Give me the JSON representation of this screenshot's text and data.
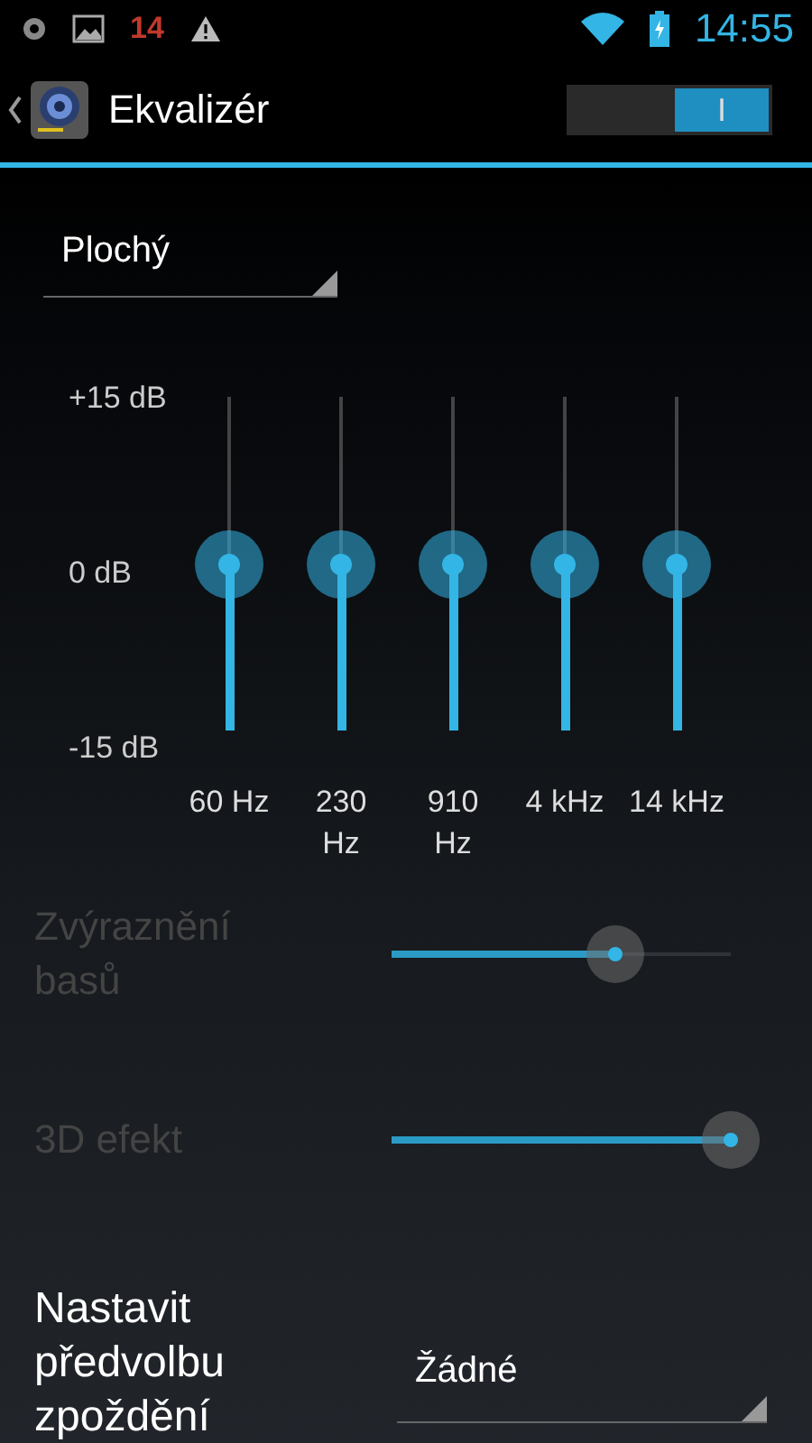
{
  "status_bar": {
    "notification_count": "14",
    "time": "14:55"
  },
  "action_bar": {
    "title": "Ekvalizér",
    "switch": {
      "on": true,
      "label": "I"
    }
  },
  "preset": {
    "value": "Plochý"
  },
  "equalizer": {
    "scale": [
      "+15 dB",
      "0 dB",
      "-15 dB"
    ],
    "bands": [
      {
        "label": "60 Hz",
        "level": 0.5
      },
      {
        "label": "230\nHz",
        "level": 0.5
      },
      {
        "label": "910\nHz",
        "level": 0.5
      },
      {
        "label": "4 kHz",
        "level": 0.5
      },
      {
        "label": "14 kHz",
        "level": 0.5
      }
    ]
  },
  "effects": [
    {
      "label": "Zvýraznění basů",
      "disabled": true,
      "level": 0.66
    },
    {
      "label": "3D efekt",
      "disabled": true,
      "level": 1.0
    }
  ],
  "delay_preset": {
    "label": "Nastavit předvolbu zpoždění",
    "value": "Žádné"
  }
}
